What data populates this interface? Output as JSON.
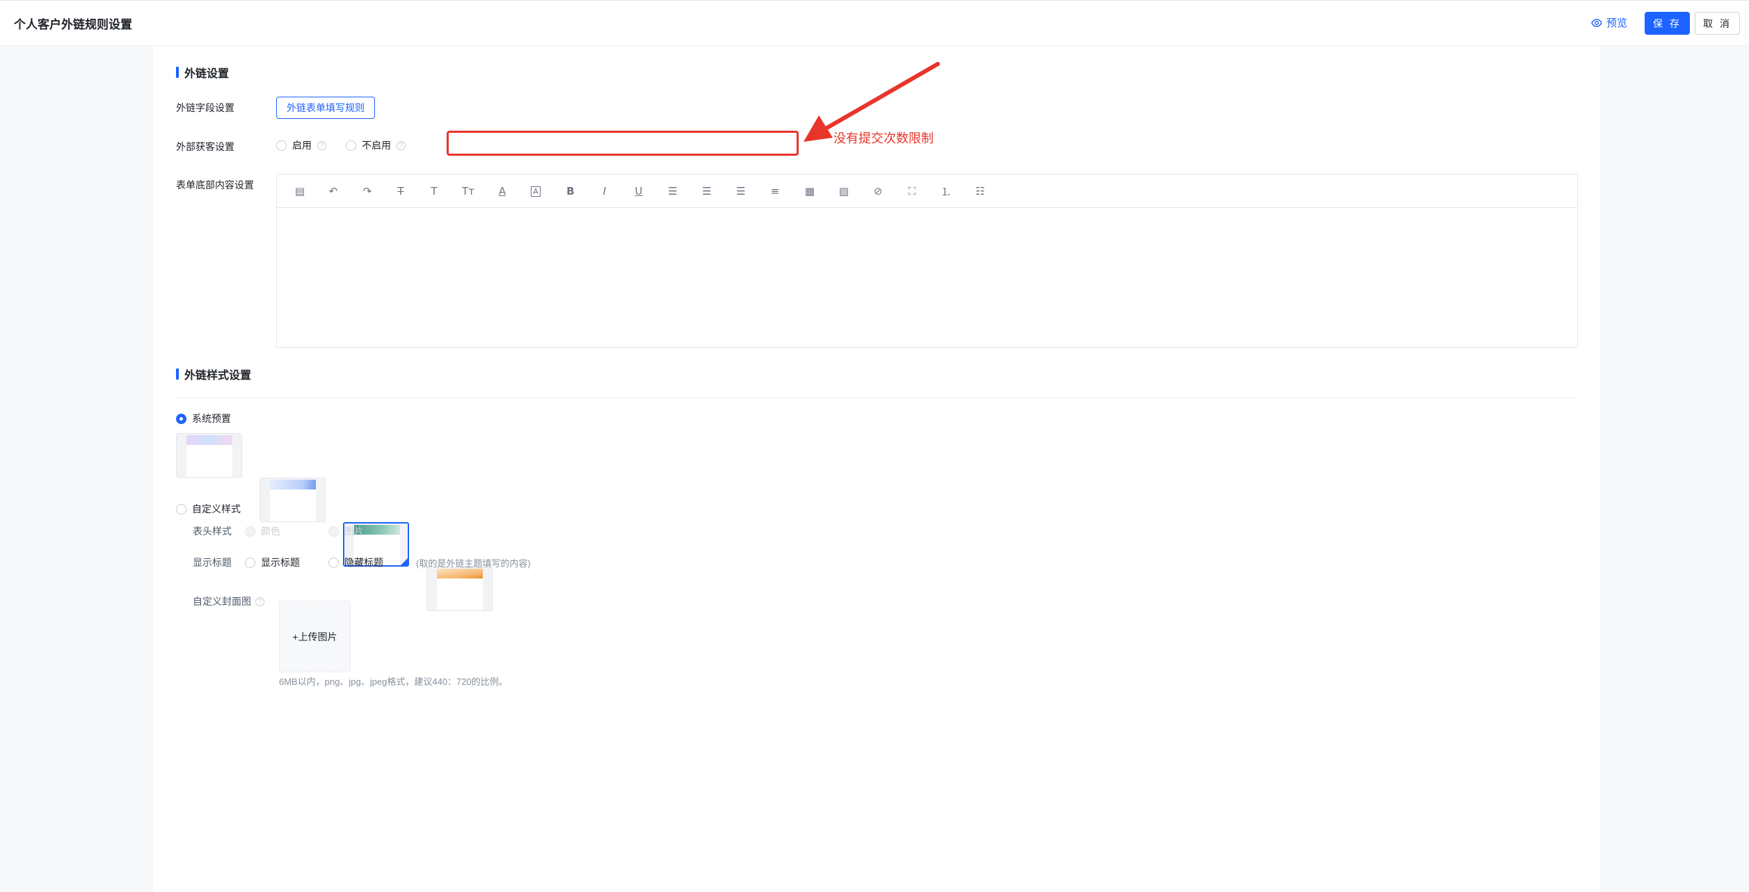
{
  "header": {
    "title": "个人客户外链规则设置",
    "preview_label": "预览",
    "save_label": "保 存",
    "cancel_label": "取 消"
  },
  "link_settings": {
    "section_title": "外链设置",
    "field_setting_label": "外链字段设置",
    "field_rules_button": "外链表单填写规则",
    "external_acquire_label": "外部获客设置",
    "enable_label": "启用",
    "disable_label": "不启用",
    "footer_content_label": "表单底部内容设置"
  },
  "annotation": {
    "text": "没有提交次数限制",
    "color": "#e8352b"
  },
  "editor_toolbar": [
    "template-icon",
    "undo-icon",
    "redo-icon",
    "strikethrough-icon",
    "text-icon",
    "font-size-icon",
    "font-color-icon",
    "background-color-icon",
    "bold-icon",
    "italic-icon",
    "underline-icon",
    "align-left-icon",
    "align-center-icon",
    "align-right-icon",
    "justify-icon",
    "table-icon",
    "image-icon",
    "attachment-icon",
    "fullscreen-icon",
    "ordered-list-icon",
    "bullet-list-icon"
  ],
  "style_settings": {
    "section_title": "外链样式设置",
    "system_preset_label": "系统预置",
    "presets": [
      {
        "name": "preset-pink-purple",
        "selected": false
      },
      {
        "name": "preset-blue",
        "selected": false
      },
      {
        "name": "preset-teal",
        "selected": true
      },
      {
        "name": "preset-orange",
        "selected": false
      }
    ],
    "custom_style_label": "自定义样式",
    "header_style_label": "表头样式",
    "color_option": "颜色",
    "image_option": "图片",
    "show_title_label": "显示标题",
    "show_title_option": "显示标题",
    "hide_title_option": "隐藏标题",
    "title_note": "(取的是外链主题填写的内容)",
    "cover_label": "自定义封面图",
    "upload_label": "+上传图片",
    "upload_hint": "6MB以内，png、jpg、jpeg格式，建议440：720的比例。"
  },
  "colors": {
    "accent": "#1d63ff",
    "annotation": "#e8352b"
  }
}
